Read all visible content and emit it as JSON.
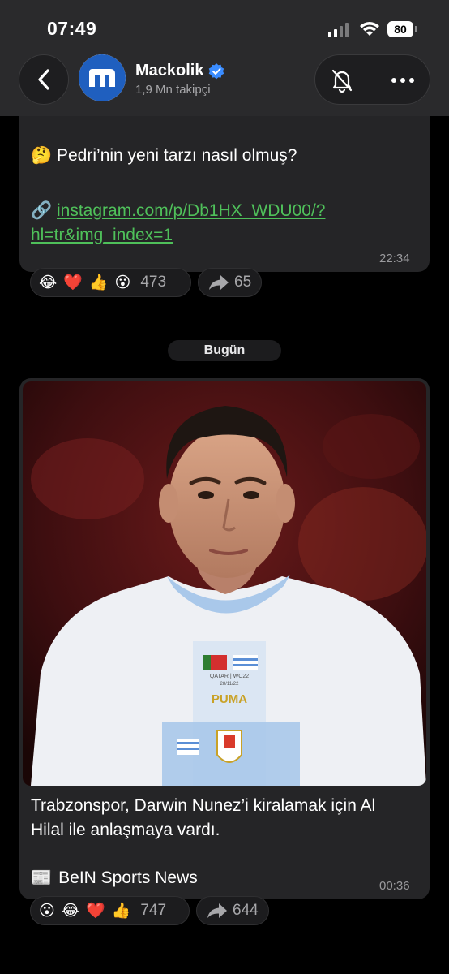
{
  "status": {
    "time": "07:49",
    "battery": "80"
  },
  "channel": {
    "name": "Mackolik",
    "subscribers": "1,9 Mn takipçi",
    "avatar_letter": "m"
  },
  "messages": [
    {
      "text": "Pedri’nin yeni tarzı nasıl olmuş?",
      "text_emoji": "🤔",
      "link_emoji": "🔗",
      "link": "instagram.com/p/Db1HX_WDU00/?hl=tr&img_index=1",
      "link_line1": "instagram.com/p/Db1HX_WDU00/?",
      "link_line2": "hl=tr&img_index=1",
      "time": "22:34",
      "reactions": [
        "😂",
        "❤️",
        "👍",
        "😮"
      ],
      "reaction_count": "473",
      "share_count": "65"
    },
    {
      "caption": "Trabzonspor, Darwin Nunez’i kiralamak için Al Hilal ile anlaşmaya vardı.",
      "source_emoji": "📰",
      "source": "BeIN Sports News",
      "time": "00:36",
      "reactions": [
        "😮",
        "😂",
        "❤️",
        "👍"
      ],
      "reaction_count": "747",
      "share_count": "644",
      "photo": {
        "shirt_text": "PUMA",
        "event_text": "QATAR | WC22",
        "date_text": "28/11/22"
      }
    }
  ],
  "date_separator": "Bugün",
  "colors": {
    "link": "#4fc05a",
    "bubble": "#252527",
    "header": "#2a2a2c",
    "verified": "#3a8cff",
    "avatar": "#1f5fbf"
  },
  "icons": [
    "back-arrow-icon",
    "verified-icon",
    "bell-off-icon",
    "more-icon",
    "share-arrow-icon"
  ]
}
